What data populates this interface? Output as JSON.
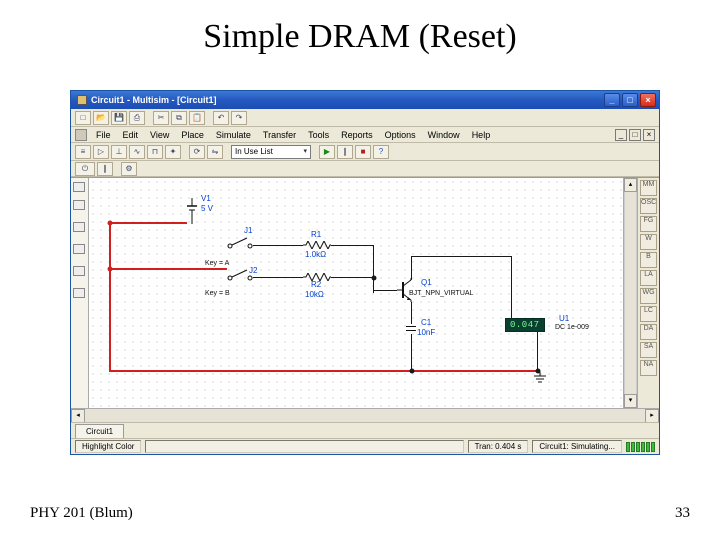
{
  "slide": {
    "title": "Simple DRAM (Reset)",
    "footer_left": "PHY 201 (Blum)",
    "footer_right": "33"
  },
  "window": {
    "title": "Circuit1 - Multisim - [Circuit1]",
    "min_label": "_",
    "max_label": "□",
    "close_label": "×"
  },
  "menu": {
    "file": "File",
    "edit": "Edit",
    "view": "View",
    "place": "Place",
    "simulate": "Simulate",
    "transfer": "Transfer",
    "tools": "Tools",
    "reports": "Reports",
    "options": "Options",
    "window": "Window",
    "help": "Help"
  },
  "mdi": {
    "min": "_",
    "max": "□",
    "close": "×"
  },
  "toolbar": {
    "in_use_list": "In Use List"
  },
  "tabs": {
    "circuit1": "Circuit1"
  },
  "status": {
    "highlight": "Highlight Color",
    "tran": "Tran: 0.404 s",
    "simulating": "Circuit1: Simulating..."
  },
  "circuit": {
    "v1_name": "V1",
    "v1_val": "5 V",
    "j1": "J1",
    "j1_key": "Key = A",
    "j2": "J2",
    "j2_key": "Key = B",
    "r1_name": "R1",
    "r1_val": "1.0kΩ",
    "r2_name": "R2",
    "r2_val": "10kΩ",
    "q1_name": "Q1",
    "q1_val": "BJT_NPN_VIRTUAL",
    "c1_name": "C1",
    "c1_val": "10nF",
    "u1_name": "U1",
    "u1_val": "DC 1e-009",
    "meter_reading": "0.047"
  }
}
